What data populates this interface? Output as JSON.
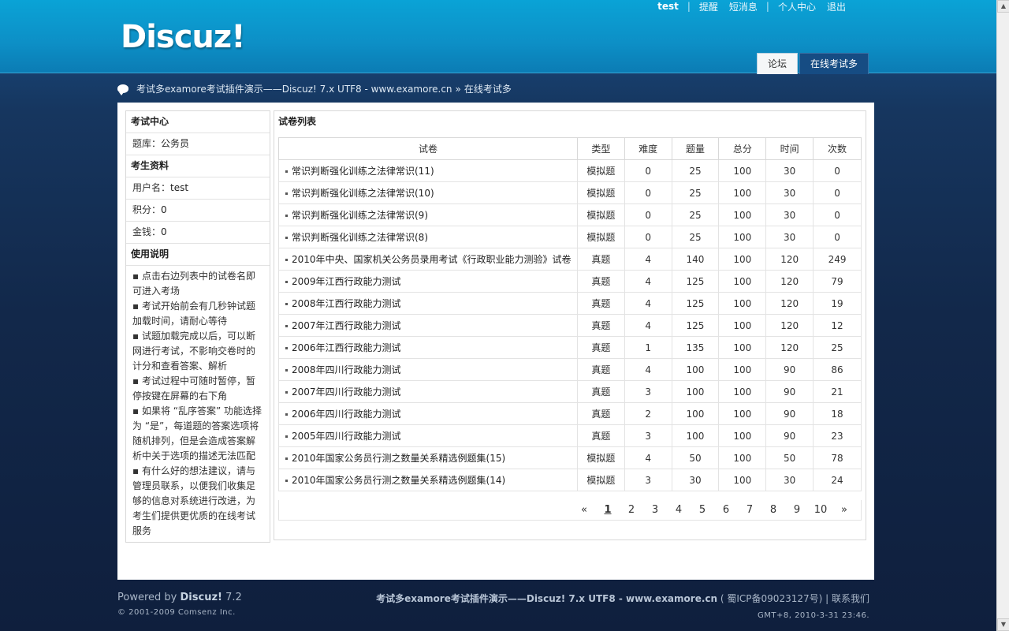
{
  "header": {
    "logo": "Discuz!",
    "nav": {
      "username": "test",
      "remind": "提醒",
      "messages": "短消息",
      "profile": "个人中心",
      "logout": "退出"
    },
    "tabs": [
      {
        "label": "论坛"
      },
      {
        "label": "在线考试多"
      }
    ]
  },
  "breadcrumb": {
    "site": "考试多examore考试插件演示——Discuz! 7.x UTF8 - www.examore.cn",
    "separator": "»",
    "current": "在线考试多"
  },
  "sidebar": {
    "exam_center_title": "考试中心",
    "bank_label": "题库：",
    "bank_value": "公务员",
    "profile_title": "考生资料",
    "username_label": "用户名：",
    "username_value": "test",
    "points_label": "积分：",
    "points_value": "0",
    "money_label": "金钱：",
    "money_value": "0",
    "help_title": "使用说明",
    "help_items": [
      "▪ 点击右边列表中的试卷名即可进入考场",
      "▪ 考试开始前会有几秒钟试题加载时间，请耐心等待",
      "▪ 试题加载完成以后，可以断网进行考试，不影响交卷时的计分和查看答案、解析",
      "▪ 考试过程中可随时暂停，暂停按键在屏幕的右下角",
      "▪ 如果将 “乱序答案” 功能选择为 “是”，每道题的答案选项将随机排列，但是会造成答案解析中关于选项的描述无法匹配",
      "▪ 有什么好的想法建议，请与管理员联系，以便我们收集足够的信息对系统进行改进，为考生们提供更优质的在线考试服务"
    ]
  },
  "content": {
    "title": "试卷列表",
    "columns": [
      "试卷",
      "类型",
      "难度",
      "题量",
      "总分",
      "时间",
      "次数"
    ],
    "rows": [
      [
        "常识判断强化训练之法律常识(11)",
        "模拟题",
        "0",
        "25",
        "100",
        "30",
        "0"
      ],
      [
        "常识判断强化训练之法律常识(10)",
        "模拟题",
        "0",
        "25",
        "100",
        "30",
        "0"
      ],
      [
        "常识判断强化训练之法律常识(9)",
        "模拟题",
        "0",
        "25",
        "100",
        "30",
        "0"
      ],
      [
        "常识判断强化训练之法律常识(8)",
        "模拟题",
        "0",
        "25",
        "100",
        "30",
        "0"
      ],
      [
        "2010年中央、国家机关公务员录用考试《行政职业能力测验》试卷",
        "真题",
        "4",
        "140",
        "100",
        "120",
        "249"
      ],
      [
        "2009年江西行政能力测试",
        "真题",
        "4",
        "125",
        "100",
        "120",
        "79"
      ],
      [
        "2008年江西行政能力测试",
        "真题",
        "4",
        "125",
        "100",
        "120",
        "19"
      ],
      [
        "2007年江西行政能力测试",
        "真题",
        "4",
        "125",
        "100",
        "120",
        "12"
      ],
      [
        "2006年江西行政能力测试",
        "真题",
        "1",
        "135",
        "100",
        "120",
        "25"
      ],
      [
        "2008年四川行政能力测试",
        "真题",
        "4",
        "100",
        "100",
        "90",
        "86"
      ],
      [
        "2007年四川行政能力测试",
        "真题",
        "3",
        "100",
        "100",
        "90",
        "21"
      ],
      [
        "2006年四川行政能力测试",
        "真题",
        "2",
        "100",
        "100",
        "90",
        "18"
      ],
      [
        "2005年四川行政能力测试",
        "真题",
        "3",
        "100",
        "100",
        "90",
        "23"
      ],
      [
        "2010年国家公务员行测之数量关系精选例题集(15)",
        "模拟题",
        "4",
        "50",
        "100",
        "50",
        "78"
      ],
      [
        "2010年国家公务员行测之数量关系精选例题集(14)",
        "模拟题",
        "3",
        "30",
        "100",
        "30",
        "24"
      ]
    ],
    "pager": [
      "«",
      "1",
      "2",
      "3",
      "4",
      "5",
      "6",
      "7",
      "8",
      "9",
      "10",
      "»"
    ],
    "current_page": "1"
  },
  "footer": {
    "powered_prefix": "Powered by",
    "powered_product": "Discuz!",
    "powered_version": "7.2",
    "copyright": "© 2001-2009 Comsenz Inc.",
    "site_name": "考试多examore考试插件演示——Discuz! 7.x UTF8 - www.examore.cn",
    "icp": "( 蜀ICP备09023127号)",
    "contact": "| 联系我们",
    "gmt": "GMT+8, 2010-3-31 23:46."
  }
}
